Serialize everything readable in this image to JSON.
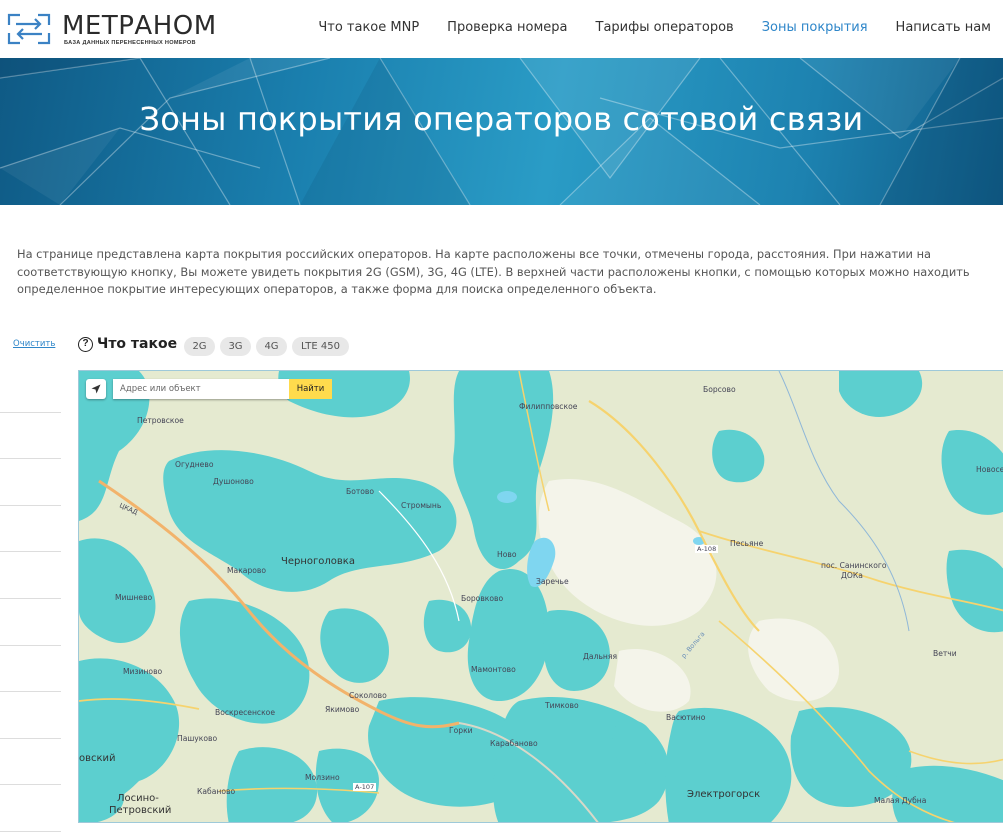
{
  "header": {
    "logo_name": "МЕТРАНОМ",
    "logo_sub": "БАЗА ДАННЫХ ПЕРЕНЕСЕННЫХ НОМЕРОВ",
    "nav": [
      {
        "label": "Что такое MNP",
        "active": false
      },
      {
        "label": "Проверка номера",
        "active": false
      },
      {
        "label": "Тарифы операторов",
        "active": false
      },
      {
        "label": "Зоны покрытия",
        "active": true
      },
      {
        "label": "Написать нам",
        "active": false
      }
    ]
  },
  "hero": {
    "title": "Зоны покрытия операторов сотовой связи"
  },
  "intro": {
    "text": "На странице представлена карта покрытия российских операторов. На карте расположены все точки, отмечены города, расстояния. При нажатии на соответствующую кнопку, Вы можете увидеть покрытия 2G (GSM), 3G, 4G (LTE). В верхней части расположены кнопки, с помощью которых можно находить определенное покрытие интересующих операторов, а также форма для поиска определенного объекта."
  },
  "sidebar": {
    "clear_label": "Очистить"
  },
  "controls": {
    "help_glyph": "?",
    "title": "Что такое",
    "chips": [
      "2G",
      "3G",
      "4G",
      "LTE 450"
    ]
  },
  "map": {
    "search_placeholder": "Адрес или объект",
    "search_button": "Найти",
    "coverage_color": "#5ccfcf",
    "labels": [
      {
        "text": "Петровское",
        "big": false
      },
      {
        "text": "Огудневo",
        "big": false
      },
      {
        "text": "Душоново",
        "big": false
      },
      {
        "text": "Ботово",
        "big": false
      },
      {
        "text": "Стромынь",
        "big": false
      },
      {
        "text": "Филипповское",
        "big": false
      },
      {
        "text": "Ново",
        "big": false
      },
      {
        "text": "Заречье",
        "big": false
      },
      {
        "text": "Боровково",
        "big": false
      },
      {
        "text": "Песьяне",
        "big": false
      },
      {
        "text": "пос. Санинского",
        "big": false
      },
      {
        "text": "ДОКа",
        "big": false
      },
      {
        "text": "Борcово",
        "big": false
      },
      {
        "text": "Новосе",
        "big": false
      },
      {
        "text": "Черноголовка",
        "big": true
      },
      {
        "text": "Макарово",
        "big": false
      },
      {
        "text": "Мишнево",
        "big": false
      },
      {
        "text": "Мизиново",
        "big": false
      },
      {
        "text": "Воскресенское",
        "big": false
      },
      {
        "text": "Пашуково",
        "big": false
      },
      {
        "text": "Соколово",
        "big": false
      },
      {
        "text": "Якимово",
        "big": false
      },
      {
        "text": "Горки",
        "big": false
      },
      {
        "text": "Мамонтово",
        "big": false
      },
      {
        "text": "Дальняя",
        "big": false
      },
      {
        "text": "Тимково",
        "big": false
      },
      {
        "text": "Васютино",
        "big": false
      },
      {
        "text": "Карабаново",
        "big": false
      },
      {
        "text": "Ветчи",
        "big": false
      },
      {
        "text": "Электрогорск",
        "big": true
      },
      {
        "text": "Малая Дубна",
        "big": false
      },
      {
        "text": "Кабаново",
        "big": false
      },
      {
        "text": "Молзино",
        "big": false
      },
      {
        "text": "Лосино-",
        "big": true
      },
      {
        "text": "Петровский",
        "big": true
      },
      {
        "text": "овский",
        "big": true
      },
      {
        "text": "А-108",
        "big": false
      },
      {
        "text": "А-107",
        "big": false
      },
      {
        "text": "ЦКАД",
        "big": false
      },
      {
        "text": "р. Вольга",
        "big": false
      }
    ]
  }
}
